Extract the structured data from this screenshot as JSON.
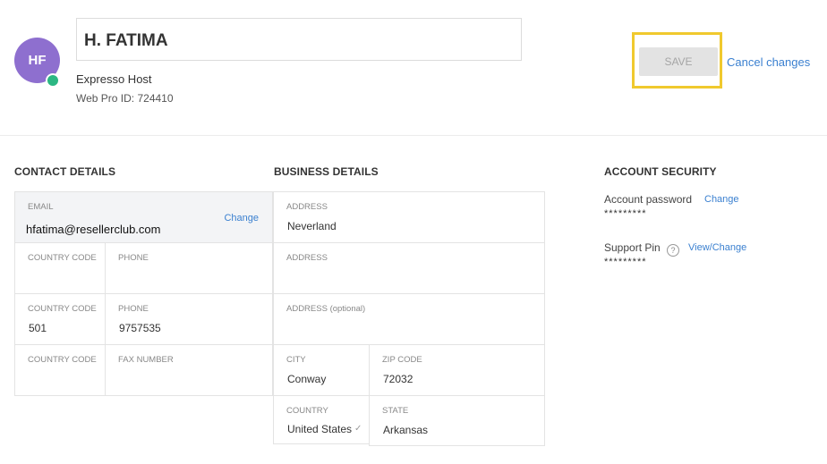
{
  "profile": {
    "initials": "HF",
    "name": "H. FATIMA",
    "company": "Expresso Host",
    "web_pro_id": "Web Pro ID: 724410"
  },
  "actions": {
    "save_label": "SAVE",
    "cancel_label": "Cancel changes"
  },
  "contact": {
    "title": "CONTACT DETAILS",
    "email_label": "EMAIL",
    "email_value": "hfatima@resellerclub.com",
    "email_change": "Change",
    "row1": {
      "cc_label": "COUNTRY CODE",
      "cc_value": "",
      "phone_label": "PHONE",
      "phone_value": ""
    },
    "row2": {
      "cc_label": "COUNTRY CODE",
      "cc_value": "501",
      "phone_label": "PHONE",
      "phone_value": "9757535"
    },
    "row3": {
      "cc_label": "COUNTRY CODE",
      "cc_value": "",
      "fax_label": "FAX NUMBER",
      "fax_value": ""
    }
  },
  "business": {
    "title": "BUSINESS DETAILS",
    "address1_label": "ADDRESS",
    "address1_value": "Neverland",
    "address2_label": "ADDRESS",
    "address2_value": "",
    "address3_label": "ADDRESS (optional)",
    "address3_value": "",
    "city_label": "CITY",
    "city_value": "Conway",
    "zip_label": "ZIP CODE",
    "zip_value": "72032",
    "country_label": "COUNTRY",
    "country_value": "United States",
    "state_label": "STATE",
    "state_value": "Arkansas"
  },
  "security": {
    "title": "ACCOUNT SECURITY",
    "password_label": "Account password",
    "password_change": "Change",
    "password_mask": "*********",
    "pin_label": "Support Pin",
    "pin_help": "?",
    "pin_change": "View/Change",
    "pin_mask": "*********"
  },
  "colors": {
    "accent": "#3b80d0",
    "avatar": "#8e6fcf",
    "online": "#2cb783",
    "highlight": "#f0c92e"
  }
}
